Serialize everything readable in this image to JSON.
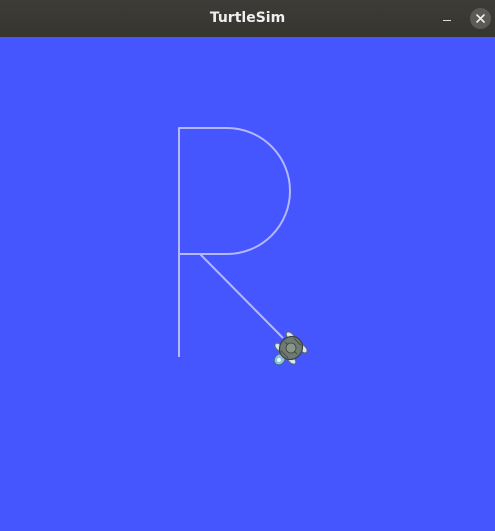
{
  "window": {
    "title": "TurtleSim"
  },
  "titlebar": {
    "minimize_icon": "minimize-icon",
    "close_icon": "close-icon"
  },
  "canvas": {
    "background_color": "#4556ff",
    "pen_color": "#b3b8ff",
    "turtle_icon": "turtle-icon"
  }
}
